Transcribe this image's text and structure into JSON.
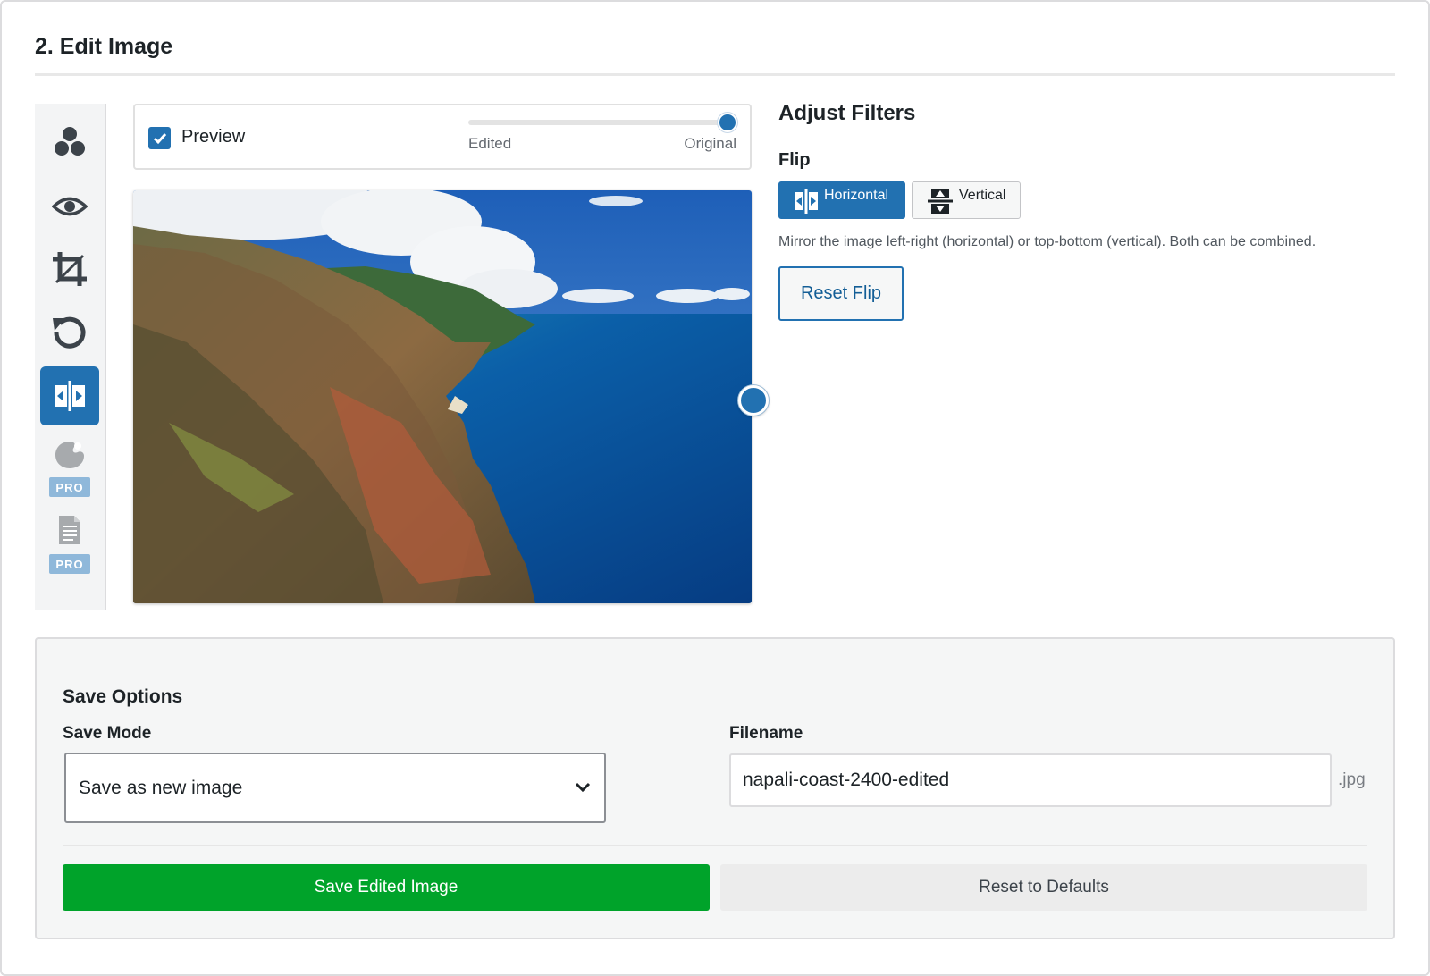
{
  "section": {
    "title": "2. Edit Image"
  },
  "toolbar": {
    "tools": [
      {
        "icon": "filters-icon",
        "active": false
      },
      {
        "icon": "eye-icon",
        "active": false
      },
      {
        "icon": "crop-icon",
        "active": false
      },
      {
        "icon": "rotate-icon",
        "active": false
      },
      {
        "icon": "flip-icon",
        "active": true
      },
      {
        "icon": "palette-icon",
        "active": false,
        "badge": "PRO"
      },
      {
        "icon": "document-icon",
        "active": false,
        "badge": "PRO"
      }
    ],
    "accent": "#2271b1"
  },
  "preview": {
    "checkbox_label": "Preview",
    "checked": true,
    "slider_left_label": "Edited",
    "slider_right_label": "Original",
    "slider_value": 1.0
  },
  "image": {
    "description_icon": "landscape-image"
  },
  "adjust": {
    "title": "Adjust Filters",
    "flip_label": "Flip",
    "horizontal_label": "Horizontal",
    "vertical_label": "Vertical",
    "description": "Mirror the image left-right (horizontal) or top-bottom (vertical). Both can be combined.",
    "reset_label": "Reset Flip"
  },
  "save": {
    "title": "Save Options",
    "mode_label": "Save Mode",
    "mode_value": "Save as new image",
    "filename_label": "Filename",
    "filename_value": "napali-coast-2400-edited",
    "extension": ".jpg",
    "save_button": "Save Edited Image",
    "reset_button": "Reset to Defaults",
    "save_color": "#00a32a"
  }
}
